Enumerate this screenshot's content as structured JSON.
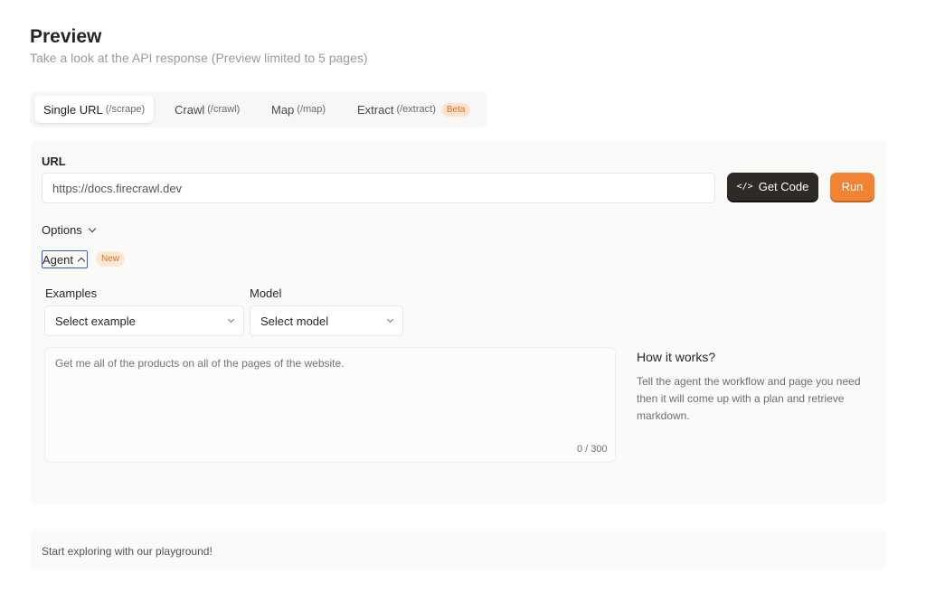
{
  "header": {
    "title": "Preview",
    "subtitle": "Take a look at the API response (Preview limited to 5 pages)"
  },
  "tabs": [
    {
      "label": "Single URL",
      "sub": "(/scrape)",
      "active": true
    },
    {
      "label": "Crawl",
      "sub": "(/crawl)"
    },
    {
      "label": "Map",
      "sub": "(/map)"
    },
    {
      "label": "Extract",
      "sub": "(/extract)",
      "badge": "Beta"
    }
  ],
  "form": {
    "url_label": "URL",
    "url_value": "https://docs.firecrawl.dev",
    "get_code_label": "Get Code",
    "get_code_icon": "</>",
    "run_label": "Run",
    "options_label": "Options",
    "agent_label": "Agent",
    "agent_badge": "New",
    "examples_label": "Examples",
    "examples_value": "Select example",
    "model_label": "Model",
    "model_value": "Select model",
    "prompt_placeholder": "Get me all of the products on all of the pages of the website.",
    "counter": "0 / 300"
  },
  "how": {
    "title": "How it works?",
    "text": "Tell the agent the workflow and page you need then it will come up with a plan and retrieve markdown."
  },
  "footer": {
    "text": "Start exploring with our playground!"
  },
  "colors": {
    "accent": "#f08434",
    "dark_button": "#2e2a27",
    "badge_bg": "#fde3cf",
    "badge_text": "#e06f22"
  }
}
